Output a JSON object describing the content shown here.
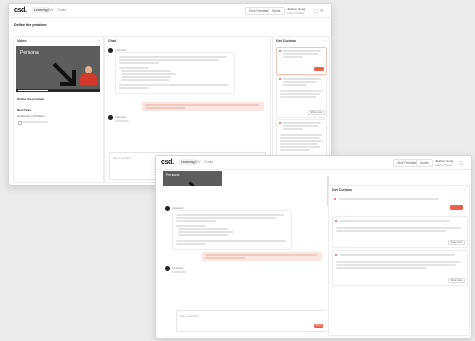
{
  "app": {
    "logo": "csd."
  },
  "nav": {
    "tabs": [
      "Learning",
      "DIY",
      "Chats"
    ]
  },
  "toolbar": {
    "share_label": "Give Feedback",
    "help_label": "Guide",
    "user_name": "Jiazhen Song",
    "user_role": "Admin Panel"
  },
  "left_panel": {
    "title": "Video",
    "video_title": "Persona",
    "problem_heading": "Define the problem",
    "notes_heading": "Best Files",
    "notes_label": "Notebook of Problem"
  },
  "chat": {
    "title": "Chat",
    "assistant_name": "Assistant",
    "input_placeholder": "Ask a question",
    "send_label": "Send"
  },
  "insights": {
    "title": "Get Curious",
    "show_more": "Show more"
  },
  "colors": {
    "accent": "#e8614c",
    "user_bubble": "#fbe6e1",
    "video_bg": "#5d5d5d"
  }
}
